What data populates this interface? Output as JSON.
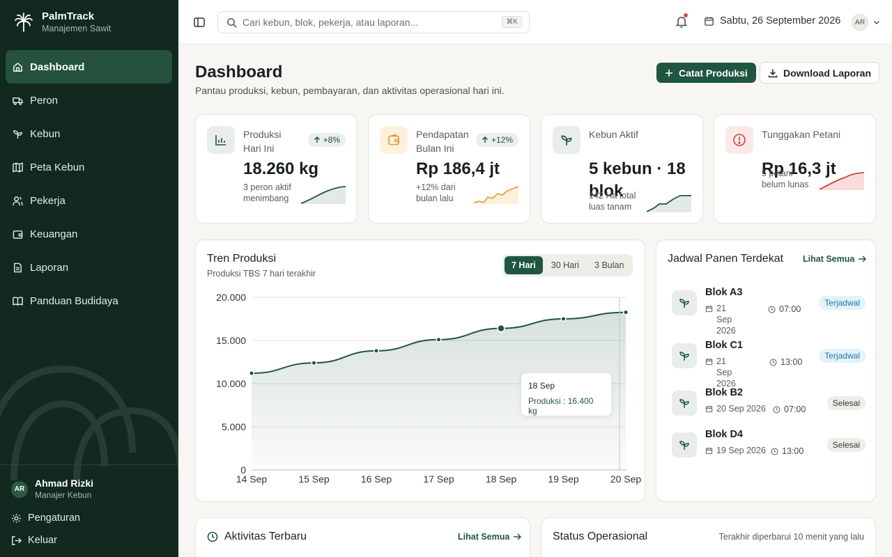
{
  "brand": {
    "name": "PalmTrack",
    "subtitle": "Manajemen Sawit"
  },
  "sidebar": {
    "items": [
      {
        "label": "Dashboard",
        "icon": "home-icon",
        "active": true
      },
      {
        "label": "Peron",
        "icon": "truck-icon"
      },
      {
        "label": "Kebun",
        "icon": "sprout-icon"
      },
      {
        "label": "Peta Kebun",
        "icon": "map-icon"
      },
      {
        "label": "Pekerja",
        "icon": "users-icon"
      },
      {
        "label": "Keuangan",
        "icon": "wallet-icon"
      },
      {
        "label": "Laporan",
        "icon": "file-icon"
      },
      {
        "label": "Panduan Budidaya",
        "icon": "book-icon"
      }
    ],
    "user": {
      "initials": "AR",
      "name": "Ahmad Rizki",
      "role": "Manajer Kebun"
    },
    "settings_label": "Pengaturan",
    "logout_label": "Keluar"
  },
  "topbar": {
    "search_placeholder": "Cari kebun, blok, pekerja, atau laporan...",
    "shortcut": "⌘K",
    "date": "Sabtu, 26 September 2026",
    "avatar_initials": "AR"
  },
  "header": {
    "title": "Dashboard",
    "subtitle": "Pantau produksi, kebun, pembayaran, dan aktivitas operasional hari ini.",
    "primary_button": "Catat Produksi",
    "secondary_button": "Download Laporan"
  },
  "stats": [
    {
      "label": "Produksi Hari Ini",
      "badge": "+8%",
      "value": "18.260 kg",
      "note": "3 peron aktif menimbang",
      "icon": "bar-chart-icon",
      "accent": "#1f5640"
    },
    {
      "label": "Pendapatan Bulan Ini",
      "badge": "+12%",
      "value": "Rp 186,4 jt",
      "note": "+12% dari bulan lalu",
      "icon": "wallet-icon",
      "accent": "#e9a23b"
    },
    {
      "label": "Kebun Aktif",
      "value": "5 kebun · 18 blok",
      "note": "142 Ha total luas tanam",
      "icon": "sprout-icon",
      "accent": "#1f5640"
    },
    {
      "label": "Tunggakan Petani",
      "value": "Rp 16,3 jt",
      "note": "5 petani belum lunas",
      "icon": "alert-icon",
      "accent": "#c8443c"
    }
  ],
  "trend": {
    "title": "Tren Produksi",
    "subtitle": "Produksi TBS 7 hari terakhir",
    "ranges": [
      "7 Hari",
      "30 Hari",
      "3 Bulan"
    ],
    "active_range": "7 Hari",
    "tooltip": {
      "date": "18 Sep",
      "text": "Produksi : 16.400 kg"
    }
  },
  "chart_data": {
    "type": "area",
    "categories": [
      "14 Sep",
      "15 Sep",
      "16 Sep",
      "17 Sep",
      "18 Sep",
      "19 Sep",
      "20 Sep"
    ],
    "series": [
      {
        "values": [
          11200,
          12400,
          13800,
          15100,
          16400,
          17500,
          18260
        ]
      }
    ],
    "ylim": [
      0,
      20000
    ],
    "yticks": [
      0,
      5000,
      10000,
      15000,
      20000
    ],
    "ytick_labels": [
      "0",
      "5.000",
      "10.000",
      "15.000",
      "20.000"
    ],
    "grid": true,
    "color": "#1f5640"
  },
  "schedule": {
    "title": "Jadwal Panen Terdekat",
    "see_all": "Lihat Semua",
    "items": [
      {
        "name": "Blok A3",
        "date": "21 Sep 2026",
        "time": "07:00",
        "status": "Terjadwal"
      },
      {
        "name": "Blok C1",
        "date": "21 Sep 2026",
        "time": "13:00",
        "status": "Terjadwal"
      },
      {
        "name": "Blok B2",
        "date": "20 Sep 2026",
        "time": "07:00",
        "status": "Selesai"
      },
      {
        "name": "Blok D4",
        "date": "19 Sep 2026",
        "time": "13:00",
        "status": "Selesai"
      }
    ]
  },
  "activity": {
    "title": "Aktivitas Terbaru",
    "see_all": "Lihat Semua"
  },
  "ops": {
    "title": "Status Operasional",
    "updated": "Terakhir diperbarui 10 menit yang lalu"
  }
}
